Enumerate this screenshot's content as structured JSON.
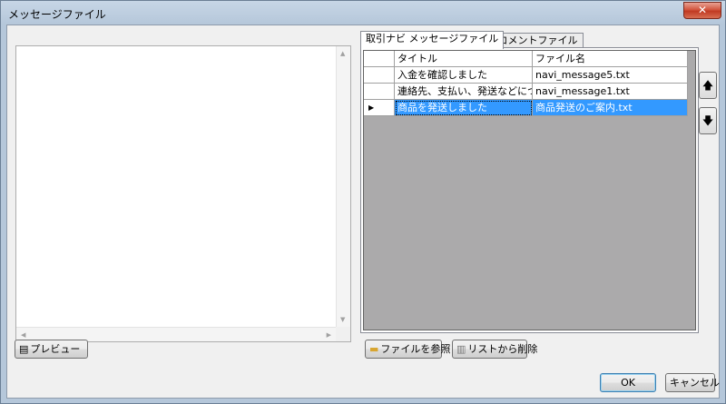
{
  "window": {
    "title": "メッセージファイル",
    "close_glyph": "✕"
  },
  "tabs": [
    {
      "label": "取引ナビ メッセージファイル",
      "active": true
    },
    {
      "label": "評価 コメントファイル",
      "active": false
    }
  ],
  "grid": {
    "columns": [
      "タイトル",
      "ファイル名"
    ],
    "rows": [
      {
        "title": "入金を確認しました",
        "file": "navi_message5.txt"
      },
      {
        "title": "連絡先、支払い、発送などについて",
        "file": "navi_message1.txt"
      },
      {
        "title": "商品を発送しました",
        "file": "商品発送のご案内.txt",
        "selected": true
      }
    ],
    "current_row_marker": "▶"
  },
  "buttons": {
    "preview": "プレビュー",
    "browse": "ファイルを参照",
    "remove": "リストから削除",
    "ok": "OK",
    "cancel": "キャンセル",
    "move_up": "🡅",
    "move_down": "🡇"
  },
  "icons": {
    "preview": "page-icon",
    "browse": "folder-icon",
    "remove": "trash-icon"
  },
  "colors": {
    "selection": "#3399ff",
    "grid_background": "#abaaab",
    "close_button": "#c03a22"
  }
}
